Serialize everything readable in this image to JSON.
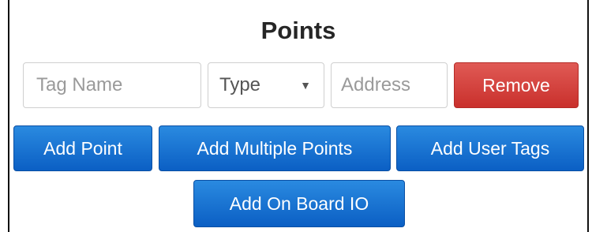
{
  "panel": {
    "title": "Points"
  },
  "form": {
    "tag_name_placeholder": "Tag Name",
    "type_select_value": "Type",
    "address_placeholder": "Address",
    "remove_label": "Remove"
  },
  "actions": {
    "add_point_label": "Add Point",
    "add_multiple_label": "Add Multiple Points",
    "add_user_tags_label": "Add User Tags",
    "add_onboard_io_label": "Add On Board IO"
  },
  "icons": {
    "select_arrow": "▼"
  },
  "colors": {
    "primary_blue": "#0b5fc4",
    "danger_red": "#c9302c"
  }
}
